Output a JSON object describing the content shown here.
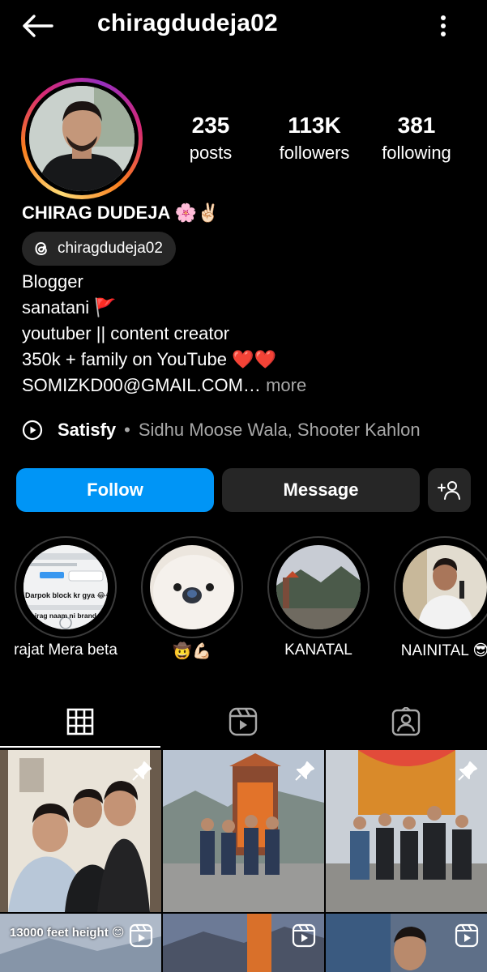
{
  "header": {
    "username": "chiragdudeja02",
    "back_icon": "arrow-left-icon",
    "more_icon": "vertical-dots-icon"
  },
  "profile": {
    "stats": {
      "posts": {
        "value": "235",
        "label": "posts"
      },
      "followers": {
        "value": "113K",
        "label": "followers"
      },
      "following": {
        "value": "381",
        "label": "following"
      }
    },
    "full_name": "CHIRAG DUDEJA 🌸✌🏻",
    "threads_handle": "chiragdudeja02",
    "bio_lines": [
      "Blogger",
      "sanatani 🚩",
      "youtuber || content creator",
      "350k + family on YouTube ❤️❤️",
      "SOMIZKD00@GMAIL.COM…"
    ],
    "bio_more": "more",
    "music": {
      "song": "Satisfy",
      "separator": "•",
      "artists": "Sidhu Moose Wala, Shooter Kahlon"
    }
  },
  "actions": {
    "follow_label": "Follow",
    "message_label": "Message",
    "suggest_icon": "add-person-icon"
  },
  "highlights": [
    {
      "caption": "rajat Mera beta",
      "overlay_lines": [
        "Darpok block kr gya 😂😂",
        "chirag naam ni brand h"
      ]
    },
    {
      "caption": "🤠💪🏻"
    },
    {
      "caption": "KANATAL"
    },
    {
      "caption": "NAINITAL 😎"
    }
  ],
  "tabs": [
    {
      "icon": "grid-icon",
      "selected": true
    },
    {
      "icon": "reels-icon",
      "selected": false
    },
    {
      "icon": "tagged-icon",
      "selected": false
    }
  ],
  "grid_posts": [
    {
      "type": "pinned"
    },
    {
      "type": "pinned"
    },
    {
      "type": "pinned"
    },
    {
      "type": "reel",
      "caption": "13000 feet height 😊"
    },
    {
      "type": "reel"
    },
    {
      "type": "reel"
    }
  ],
  "colors": {
    "accent": "#0095f6",
    "surface": "#262626",
    "muted_text": "#a8a8a8"
  }
}
